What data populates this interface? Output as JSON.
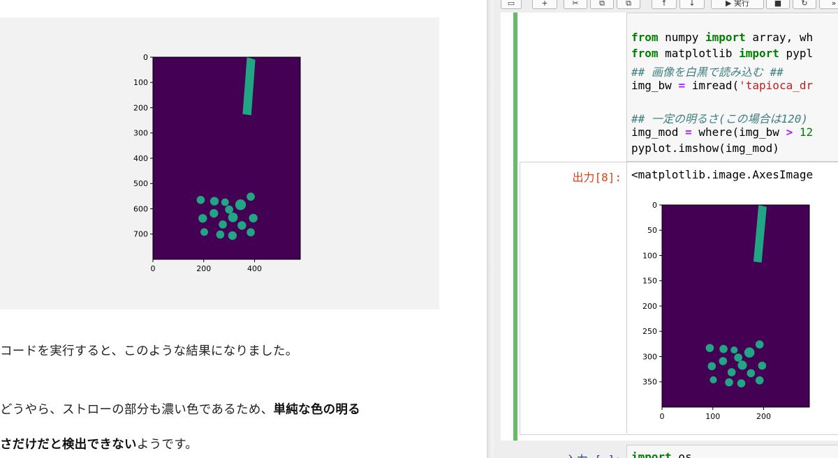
{
  "article": {
    "para1": "コードを実行すると、このような結果になりました。",
    "para2_normal": "どうやら、ストローの部分も濃い色であるため、",
    "para2_bold": "単純な色の明る",
    "para3_bold": "さだけだと検出できない",
    "para3_normal": "ようです。"
  },
  "notebook": {
    "toolbar": {
      "run_label": "▶ 実行",
      "save_icon": "save-icon",
      "add_icon": "plus-icon",
      "cut_icon": "scissors-icon",
      "copy_icon": "copy-icon",
      "paste_icon": "paste-icon",
      "up_icon": "arrow-up-icon",
      "down_icon": "arrow-down-icon",
      "stop_icon": "stop-icon",
      "restart_icon": "restart-icon",
      "ff_icon": "fast-forward-icon"
    },
    "code_lines": {
      "l1_kw1": "from",
      "l1_mid": " numpy ",
      "l1_kw2": "import",
      "l1_rest": " array, wh",
      "l2_kw1": "from",
      "l2_mid": " matplotlib ",
      "l2_kw2": "import",
      "l2_rest": " pypl",
      "l3_comment": "## 画像を白黒で読み込む ##",
      "l4_a": "img_bw ",
      "l4_op": "=",
      "l4_b": " imread(",
      "l4_str": "'tapioca_dr",
      "l5_comment": "## 一定の明るさ(この場合は120)",
      "l6_a": "img_mod ",
      "l6_op": "=",
      "l6_b": " where(img_bw ",
      "l6_op2": ">",
      "l6_num": " 12",
      "l7": "pyplot.imshow(img_mod)"
    },
    "output_prompt": "出力[8]:",
    "output_text": "<matplotlib.image.AxesImage",
    "input2_prompt": "入力 [ ]:",
    "input2_kw": "import",
    "input2_rest": " os"
  },
  "colors": {
    "image_background": "#440154",
    "straw_and_pearls": "#21a585",
    "cell_selected_bar": "#66bb6a",
    "output_prompt": "#d84315"
  },
  "chart_data": [
    {
      "type": "heatmap",
      "title": "",
      "xlabel": "",
      "ylabel": "",
      "x_ticks": [
        "0",
        "200",
        "400"
      ],
      "y_ticks": [
        "0",
        "100",
        "200",
        "300",
        "400",
        "500",
        "600",
        "700"
      ],
      "xlim": [
        0,
        580
      ],
      "ylim": [
        800,
        0
      ],
      "straw": {
        "corners": [
          [
            370,
            0
          ],
          [
            403,
            10
          ],
          [
            387,
            230
          ],
          [
            353,
            225
          ]
        ]
      },
      "pearls": [
        {
          "x": 188,
          "y": 565,
          "r": 16
        },
        {
          "x": 242,
          "y": 570,
          "r": 17
        },
        {
          "x": 284,
          "y": 574,
          "r": 15
        },
        {
          "x": 345,
          "y": 584,
          "r": 21
        },
        {
          "x": 385,
          "y": 552,
          "r": 16
        },
        {
          "x": 196,
          "y": 638,
          "r": 17
        },
        {
          "x": 240,
          "y": 618,
          "r": 17
        },
        {
          "x": 300,
          "y": 603,
          "r": 16
        },
        {
          "x": 315,
          "y": 634,
          "r": 19
        },
        {
          "x": 395,
          "y": 637,
          "r": 17
        },
        {
          "x": 275,
          "y": 662,
          "r": 16
        },
        {
          "x": 350,
          "y": 666,
          "r": 17
        },
        {
          "x": 202,
          "y": 692,
          "r": 15
        },
        {
          "x": 265,
          "y": 702,
          "r": 16
        },
        {
          "x": 313,
          "y": 706,
          "r": 17
        },
        {
          "x": 385,
          "y": 693,
          "r": 16
        }
      ]
    },
    {
      "type": "heatmap",
      "title": "",
      "xlabel": "",
      "ylabel": "",
      "x_ticks": [
        "0",
        "100",
        "200"
      ],
      "y_ticks": [
        "0",
        "50",
        "100",
        "150",
        "200",
        "250",
        "300",
        "350"
      ],
      "xlim": [
        0,
        290
      ],
      "ylim": [
        400,
        0
      ],
      "straw": {
        "corners": [
          [
            190,
            0
          ],
          [
            206,
            4
          ],
          [
            196,
            114
          ],
          [
            180,
            112
          ]
        ]
      },
      "pearls": [
        {
          "x": 94,
          "y": 283,
          "r": 8
        },
        {
          "x": 121,
          "y": 285,
          "r": 8
        },
        {
          "x": 142,
          "y": 287,
          "r": 7
        },
        {
          "x": 172,
          "y": 292,
          "r": 10
        },
        {
          "x": 192,
          "y": 276,
          "r": 8
        },
        {
          "x": 98,
          "y": 319,
          "r": 8
        },
        {
          "x": 120,
          "y": 309,
          "r": 8
        },
        {
          "x": 150,
          "y": 302,
          "r": 8
        },
        {
          "x": 158,
          "y": 317,
          "r": 9
        },
        {
          "x": 197,
          "y": 318,
          "r": 8
        },
        {
          "x": 137,
          "y": 331,
          "r": 8
        },
        {
          "x": 175,
          "y": 333,
          "r": 8
        },
        {
          "x": 101,
          "y": 346,
          "r": 7
        },
        {
          "x": 132,
          "y": 351,
          "r": 8
        },
        {
          "x": 156,
          "y": 353,
          "r": 8
        },
        {
          "x": 192,
          "y": 347,
          "r": 8
        }
      ]
    }
  ]
}
